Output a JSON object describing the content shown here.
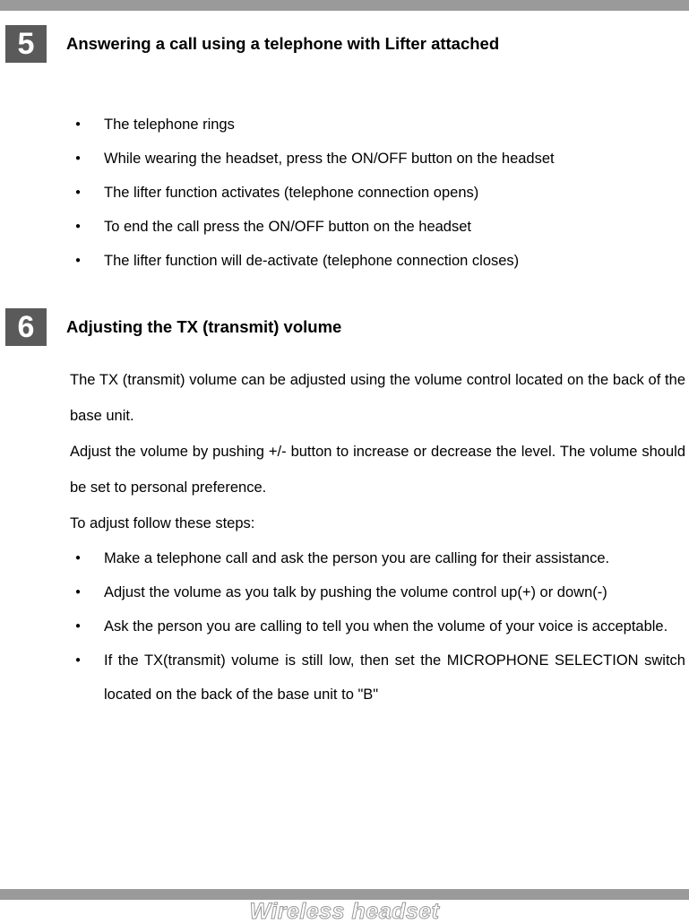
{
  "sections": [
    {
      "number": "5",
      "title": "Answering a call using a telephone with Lifter attached",
      "bullets": [
        "The telephone rings",
        "While wearing the headset, press the ON/OFF button on the headset",
        "The lifter function activates (telephone connection opens)",
        "To end the call press the ON/OFF button on the headset",
        "The lifter function will de-activate (telephone connection closes)"
      ]
    },
    {
      "number": "6",
      "title": "Adjusting the TX (transmit) volume",
      "paragraphs": [
        "The TX (transmit) volume can be adjusted using the volume control located on the back of the base unit.",
        "Adjust the volume by pushing +/- button to increase or decrease the level. The volume should be set to personal preference.",
        "To adjust follow these steps:"
      ],
      "bullets": [
        "Make a telephone call and ask the person you are calling for their assistance.",
        "Adjust the volume as you talk by pushing the volume control up(+) or down(-)",
        "Ask the person you are calling to tell you when the volume of your voice is acceptable.",
        "If the TX(transmit) volume is still low, then set the MICROPHONE SELECTION switch located on the back of the base unit to \"B\""
      ]
    }
  ],
  "footer": "Wireless headset"
}
